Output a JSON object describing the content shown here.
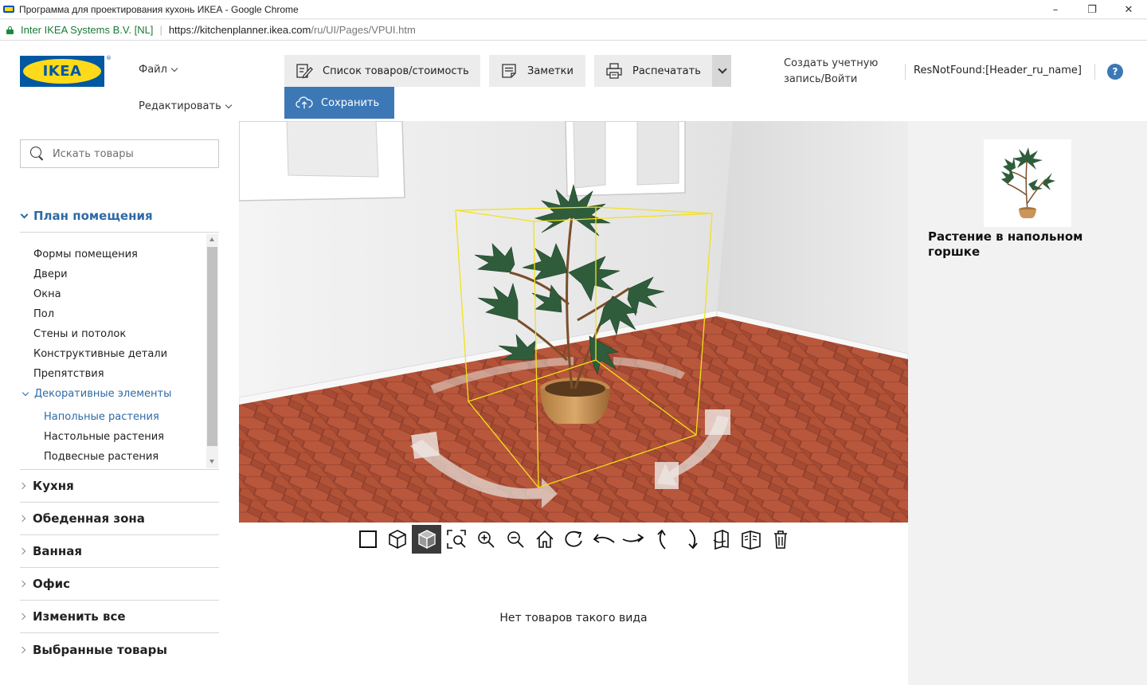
{
  "window": {
    "title": "Программа для проектирования кухонь ИКЕА - Google Chrome",
    "controls": {
      "minimize": "–",
      "maximize": "❐",
      "close": "✕"
    }
  },
  "address": {
    "secure_label": "Inter IKEA Systems B.V. [NL]",
    "url_main": "https://kitchenplanner.ikea.com",
    "url_rest": "/ru/UI/Pages/VPUI.htm"
  },
  "header": {
    "logo_text": "IKEA",
    "logo_reg": "®",
    "menu_file": "Файл",
    "menu_edit": "Редактировать",
    "btn_list": "Список товаров/стоимость",
    "btn_notes": "Заметки",
    "btn_print": "Распечатать",
    "btn_save": "Сохранить",
    "account_line1": "Создать учетную",
    "account_line2": "запись/Войти",
    "resource_name": "ResNotFound:[Header_ru_name]",
    "help": "?"
  },
  "sidebar": {
    "search_placeholder": "Искать товары",
    "open_section": "План помещения",
    "sub_items": [
      "Формы помещения",
      "Двери",
      "Окна",
      "Пол",
      "Стены и потолок",
      "Конструктивные детали",
      "Препятствия"
    ],
    "open_subsection": "Декоративные элементы",
    "leaf_items": [
      "Напольные растения",
      "Настольные растения",
      "Подвесные растения"
    ],
    "active_leaf": "Напольные растения",
    "categories": [
      "Кухня",
      "Обеденная зона",
      "Ванная",
      "Офис",
      "Изменить все",
      "Выбранные товары"
    ]
  },
  "viewer": {
    "tools": [
      "2d-view",
      "3d-view",
      "3d-solid-view",
      "zoom-fit",
      "zoom-in",
      "zoom-out",
      "home",
      "rotate",
      "pan-left",
      "pan-right",
      "tilt-up",
      "tilt-down",
      "wall-view-1",
      "wall-view-2",
      "delete"
    ],
    "selected_tool": "3d-solid-view",
    "empty_message": "Нет товаров такого вида"
  },
  "details": {
    "product_name": "Растение в напольном горшке"
  },
  "colors": {
    "ikea_blue": "#0058a3",
    "ikea_yellow": "#ffda1a",
    "accent": "#2f6aa6",
    "save_button": "#3c78b6"
  }
}
